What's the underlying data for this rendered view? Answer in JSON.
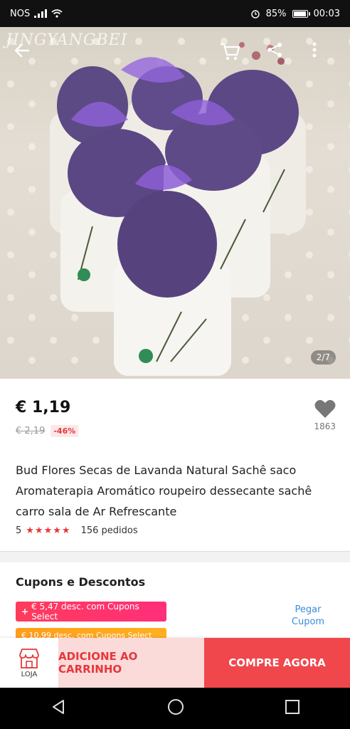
{
  "status_bar": {
    "carrier": "NOS",
    "battery": "85%",
    "battery_level": 0.85,
    "time": "00:03"
  },
  "hero": {
    "watermark": "JINGYANGBEI",
    "counter": "2/7"
  },
  "product": {
    "price": "€ 1,19",
    "old_price": "€ 2,19",
    "discount": "-46%",
    "wishlist_count": "1863",
    "title": "Bud Flores Secas de Lavanda Natural Sachê saco Aromaterapia Aromático roupeiro dessecante sachê carro sala de Ar Refrescante",
    "rating": "5",
    "stars": "★★★★★",
    "orders": "156 pedidos"
  },
  "coupons": {
    "title": "Cupons e Descontos",
    "coupon_select": "€ 5,47 desc. com Cupons Select",
    "coupon_select_icon": "+",
    "coupon_partial": "€ 10,99 desc. com Cupons Select",
    "get_coupon": "Pegar Cupom"
  },
  "actions": {
    "store_label": "LOJA",
    "add_to_cart": "ADICIONE AO CARRINHO",
    "buy_now": "COMPRE AGORA"
  },
  "colors": {
    "accent": "#e5383b",
    "buy": "#f0474c",
    "cart_bg": "#fbdada",
    "link": "#3a8ddb",
    "coupon_pink": "#ff3b5c",
    "coupon_orange": "#ffa01e"
  }
}
